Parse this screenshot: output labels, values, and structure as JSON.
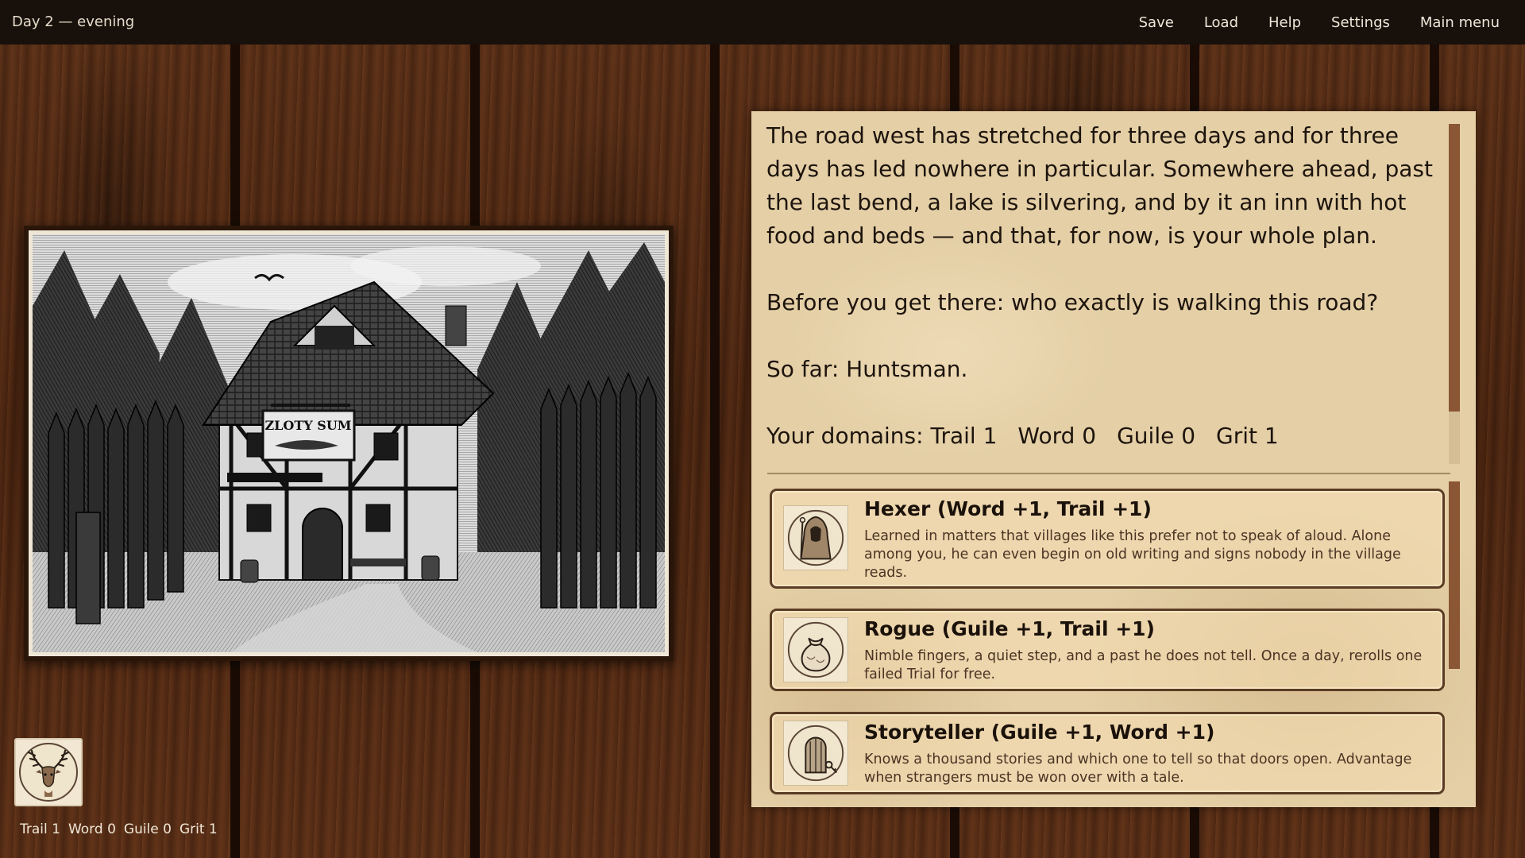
{
  "topbar": {
    "status": "Day 2 — evening",
    "menu": [
      "Save",
      "Load",
      "Help",
      "Settings",
      "Main menu"
    ]
  },
  "illustration": {
    "sign_text": "ZLOTY SUM"
  },
  "player": {
    "stats": [
      "Trail 1",
      "Word 0",
      "Guile 0",
      "Grit 1"
    ]
  },
  "story": {
    "paragraphs": [
      "The road west has stretched for three days and for three days has led nowhere in particular. Somewhere ahead, past the last bend, a lake is silvering, and by it an inn with hot food and beds — and that, for now, is your whole plan.",
      "Before you get there: who exactly is walking this road?",
      "So far: Huntsman."
    ],
    "domains_label": "Your domains:",
    "domains": [
      "Trail 1",
      "Word 0",
      "Guile 0",
      "Grit 1"
    ]
  },
  "choices": [
    {
      "title": "Hexer (Word +1, Trail +1)",
      "description": "Learned in matters that villages like this prefer not to speak of aloud. Alone among you, he can even begin on old writing and signs nobody in the village reads.",
      "icon": "hooded-figure-icon"
    },
    {
      "title": "Rogue (Guile +1, Trail +1)",
      "description": "Nimble fingers, a quiet step, and a past he does not tell. Once a day, rerolls one failed Trial for free.",
      "icon": "coin-pouch-icon"
    },
    {
      "title": "Storyteller (Guile +1, Word +1)",
      "description": "Knows a thousand stories and which one to tell so that doors open. Advantage when strangers must be won over with a tale.",
      "icon": "door-key-icon"
    }
  ],
  "colors": {
    "topbar": "#17100b",
    "parchment": "#e4cfa6",
    "choice_border": "#5a3c24",
    "scrollbar": "#8a5634"
  }
}
